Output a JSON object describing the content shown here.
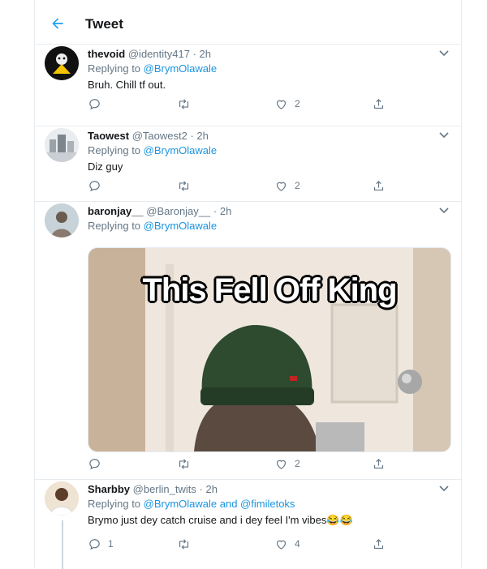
{
  "header": {
    "title": "Tweet"
  },
  "tweets": [
    {
      "name": "thevoid",
      "handle": "@identity417",
      "dot": "·",
      "time": "2h",
      "replying_prefix": "Replying to ",
      "replying_to": "@BrymOlawale",
      "text": "Bruh. Chill tf out.",
      "replies": "",
      "retweets": "",
      "likes": "2"
    },
    {
      "name": "Taowest",
      "handle": "@Taowest2",
      "dot": "·",
      "time": "2h",
      "replying_prefix": "Replying to ",
      "replying_to": "@BrymOlawale",
      "text": "Diz guy",
      "replies": "",
      "retweets": "",
      "likes": "2"
    },
    {
      "name": "baronjay__",
      "handle": "@Baronjay__",
      "dot": "·",
      "time": "2h",
      "replying_prefix": "Replying to ",
      "replying_to": "@BrymOlawale",
      "media_caption": "This Fell Off King",
      "replies": "",
      "retweets": "",
      "likes": "2"
    },
    {
      "name": "Sharbby",
      "handle": "@berlin_twits",
      "dot": "·",
      "time": "2h",
      "replying_prefix": "Replying to ",
      "replying_to": "@BrymOlawale and @fimiletoks",
      "text": "Brymo just dey catch cruise and i dey feel I'm vibes😂😂",
      "replies": "1",
      "retweets": "",
      "likes": "4"
    }
  ],
  "colors": {
    "accent": "#1b95e0",
    "muted": "#657786",
    "border": "#e6ecf0"
  },
  "icons": [
    "back-arrow-icon",
    "chevron-down-icon",
    "reply-icon",
    "retweet-icon",
    "like-icon",
    "share-icon"
  ]
}
